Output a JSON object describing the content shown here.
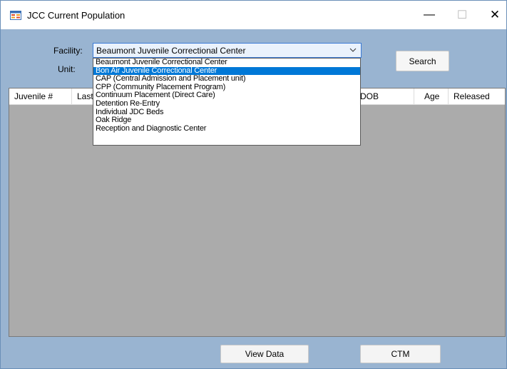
{
  "window": {
    "title": "JCC Current Population",
    "controls": {
      "minimize": "—",
      "maximize": "☐",
      "close": "✕"
    }
  },
  "form": {
    "facility_label": "Facility:",
    "unit_label": "Unit:",
    "facility_selected": "Beaumont Juvenile Correctional Center",
    "facility_options": [
      "Beaumont Juvenile Correctional Center",
      "Bon Air Juvenile Correctional Center",
      "CAP (Central Admission and Placement unit)",
      "CPP (Community Placement Program)",
      "Continuum Placement (Direct Care)",
      "Detention Re-Entry",
      "Individual JDC Beds",
      "Oak Ridge",
      "Reception and Diagnostic Center"
    ],
    "highlighted_option": "Bon Air Juvenile Correctional Center",
    "search_button": "Search"
  },
  "grid": {
    "columns": [
      "Juvenile #",
      "Last",
      "DOB",
      "Age",
      "Released"
    ]
  },
  "footer": {
    "view_data_button": "View Data",
    "ctm_button": "CTM"
  },
  "colors": {
    "client_area": "#99b4d1",
    "grid_background": "#ababab",
    "selection": "#0078d7",
    "combo_border": "#3b7bd6"
  },
  "icons": {
    "app": "app-form-icon",
    "dropdown": "chevron-down-icon"
  }
}
